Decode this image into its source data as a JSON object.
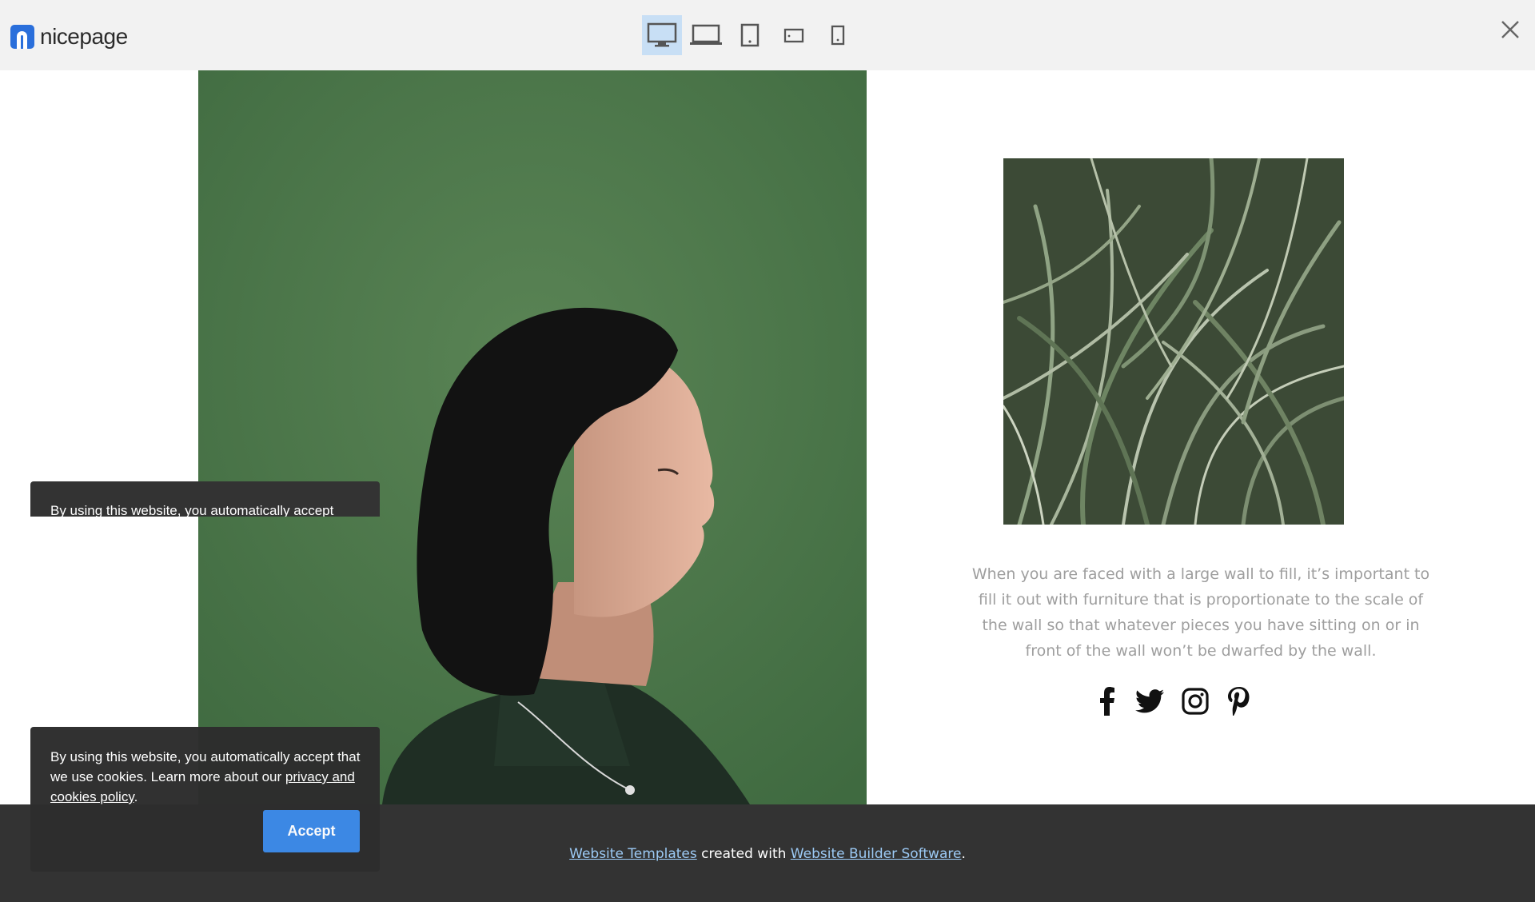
{
  "topbar": {
    "logo_text": "nicepage",
    "devices": [
      {
        "name": "desktop-icon",
        "active": true
      },
      {
        "name": "laptop-icon",
        "active": false
      },
      {
        "name": "tablet-icon",
        "active": false
      },
      {
        "name": "tablet-landscape-icon",
        "active": false
      },
      {
        "name": "phone-icon",
        "active": false
      }
    ],
    "close_icon": "close-icon"
  },
  "content": {
    "body_text": "When you are faced with a large wall to fill, it’s important to fill it out with furniture that is proportionate to the scale of the wall so that whatever pieces you have sitting on or in front of the wall won’t be dwarfed by the wall.",
    "social": [
      "facebook-icon",
      "twitter-icon",
      "instagram-icon",
      "pinterest-icon"
    ]
  },
  "footer": {
    "link1": "Website Templates",
    "middle": " created with ",
    "link2": "Website Builder Software",
    "end": "."
  },
  "cookie": {
    "ghost_text": "By using this website, you automatically accept",
    "text": "By using this website, you automatically accept that we use cookies. Learn more about our ",
    "policy_link": "privacy and cookies policy",
    "end": ".",
    "accept_label": "Accept"
  },
  "colors": {
    "accent": "#3d8ae8",
    "footer_bg": "#333333",
    "topbar_bg": "#f2f2f2",
    "active_device": "#c8dff5"
  }
}
